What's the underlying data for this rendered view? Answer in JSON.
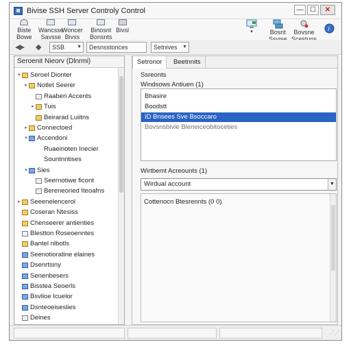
{
  "window": {
    "title": "Bivise SSH Server Controly Control"
  },
  "ribbon": {
    "items": [
      {
        "label1": "Biste",
        "label2": "Bowe",
        "icon": "user-icon"
      },
      {
        "label1": "Wancsse",
        "label2": "Savsse",
        "icon": "server-icon"
      },
      {
        "label1": "Woncer",
        "label2": "Bivss",
        "icon": "console-icon"
      },
      {
        "label1": "Binosnt",
        "label2": "Bonsnts",
        "icon": "settings-icon"
      },
      {
        "label1": "Bivsl",
        "label2": "",
        "icon": "terminal-icon"
      }
    ],
    "right_items": [
      {
        "label1": "",
        "label2": "",
        "icon": "monitor-icon"
      },
      {
        "label1": "Bosnt",
        "label2": "Ssvise",
        "icon": "network-icon"
      },
      {
        "label1": "Bovsne",
        "label2": "Scestuns",
        "icon": "globe-icon"
      },
      {
        "label1": "",
        "label2": "",
        "icon": "help-icon"
      }
    ]
  },
  "toolbar": {
    "combo1": "SSB",
    "combo2": "Desnsstonces",
    "combo3": "Setnives"
  },
  "left_pane": {
    "header": "Seroenit Nieorv (Dlnrmi)",
    "tree": [
      {
        "label": "Seroel Dionter",
        "indent": 0,
        "icon": "folder",
        "twisty": "▾"
      },
      {
        "label": "Notlet Seerer",
        "indent": 1,
        "icon": "folder",
        "twisty": "▸"
      },
      {
        "label": "Raaberi Accents",
        "indent": 2,
        "icon": "page",
        "twisty": ""
      },
      {
        "label": "Tuis",
        "indent": 2,
        "icon": "folder",
        "twisty": "▸"
      },
      {
        "label": "Beirarad Luiitns",
        "indent": 2,
        "icon": "folder",
        "twisty": ""
      },
      {
        "label": "Connectoed",
        "indent": 1,
        "icon": "folder",
        "twisty": "▸"
      },
      {
        "label": "Accendoni",
        "indent": 1,
        "icon": "blue",
        "twisty": "▾"
      },
      {
        "label": "Ruaeirioten Inecier",
        "indent": 2,
        "icon": "none",
        "twisty": ""
      },
      {
        "label": "Sountnntises",
        "indent": 2,
        "icon": "none",
        "twisty": ""
      },
      {
        "label": "Sies",
        "indent": 1,
        "icon": "blue",
        "twisty": "▾"
      },
      {
        "label": "Seernotiwe ficont",
        "indent": 2,
        "icon": "page",
        "twisty": ""
      },
      {
        "label": "Bereneoried Iteoafns",
        "indent": 2,
        "icon": "page",
        "twisty": ""
      },
      {
        "label": "Seeenelencerol",
        "indent": 0,
        "icon": "folder",
        "twisty": "▸"
      },
      {
        "label": "Coseran Ntesiss",
        "indent": 0,
        "icon": "folder",
        "twisty": ""
      },
      {
        "label": "Chenseerer antienties",
        "indent": 0,
        "icon": "folder",
        "twisty": ""
      },
      {
        "label": "Blestton Roseoenntes",
        "indent": 0,
        "icon": "page",
        "twisty": ""
      },
      {
        "label": "Bantel nlbotls",
        "indent": 0,
        "icon": "folder",
        "twisty": ""
      },
      {
        "label": "Seenotioratine elaines",
        "indent": 0,
        "icon": "blue",
        "twisty": ""
      },
      {
        "label": "Dsenrtsiny",
        "indent": 0,
        "icon": "blue",
        "twisty": ""
      },
      {
        "label": "Senenbesers",
        "indent": 0,
        "icon": "blue",
        "twisty": ""
      },
      {
        "label": "Bisstea Seoerls",
        "indent": 0,
        "icon": "blue",
        "twisty": ""
      },
      {
        "label": "Bsvlioe Icuelor",
        "indent": 0,
        "icon": "blue",
        "twisty": ""
      },
      {
        "label": "Dsnteoeiseslies",
        "indent": 0,
        "icon": "blue",
        "twisty": ""
      },
      {
        "label": "Deines",
        "indent": 0,
        "icon": "page",
        "twisty": ""
      }
    ]
  },
  "right_pane": {
    "tabs": [
      "Setronor",
      "Beetnnits"
    ],
    "section_label": "Ssreonts",
    "list_label": "Windsows Antiuen (1)",
    "list_items": [
      {
        "label": "Bhasire",
        "state": "normal"
      },
      {
        "label": "Boodstt",
        "state": "normal"
      },
      {
        "label": "ID Bnsees Sve Bsoccaro",
        "state": "selected"
      },
      {
        "label": "Bovsnsbivie Bleneiceobitoceties",
        "state": "faint"
      }
    ],
    "combo_label": "Wirtbemt Acreounts (1)",
    "combo_value": "Wirdual account",
    "text_header": "Cottenocn Btesrennts (0 0)"
  }
}
